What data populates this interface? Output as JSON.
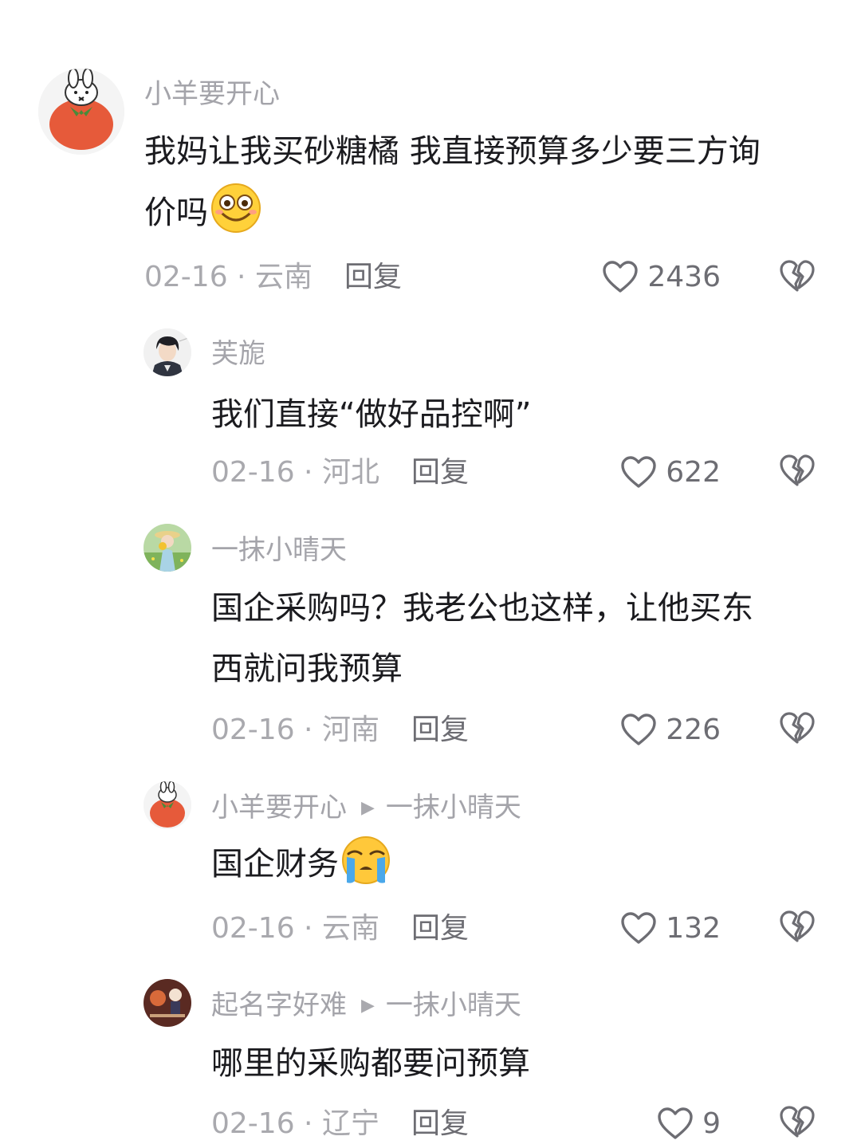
{
  "comments": [
    {
      "user": "小羊要开心",
      "text_line1": "我妈让我买砂糖橘 我直接预算多少要三方询",
      "text_line2": "价吗",
      "emoji": "smile-emoji",
      "date": "02-16 · 云南",
      "reply": "回复",
      "likes": "2436"
    },
    {
      "user": "芙旎",
      "text": "我们直接“做好品控啊”",
      "date": "02-16 · 河北",
      "reply": "回复",
      "likes": "622"
    },
    {
      "user": "一抹小晴天",
      "text_line1": "国企采购吗？我老公也这样，让他买东",
      "text_line2": "西就问我预算",
      "date": "02-16 · 河南",
      "reply": "回复",
      "likes": "226"
    },
    {
      "user": "小羊要开心",
      "reply_to": "一抹小晴天",
      "text": "国企财务",
      "emoji": "crying-emoji",
      "date": "02-16 · 云南",
      "reply": "回复",
      "likes": "132"
    },
    {
      "user": "起名字好难",
      "reply_to": "一抹小晴天",
      "text": "哪里的采购都要问预算",
      "date": "02-16 · 辽宁",
      "reply": "回复",
      "likes": "9"
    }
  ],
  "icons": {
    "like": "heart-outline-icon",
    "dislike": "broken-heart-icon"
  },
  "colors": {
    "username": "#a4a4aa",
    "text": "#1b1b1f",
    "meta": "#a9a9ae"
  }
}
